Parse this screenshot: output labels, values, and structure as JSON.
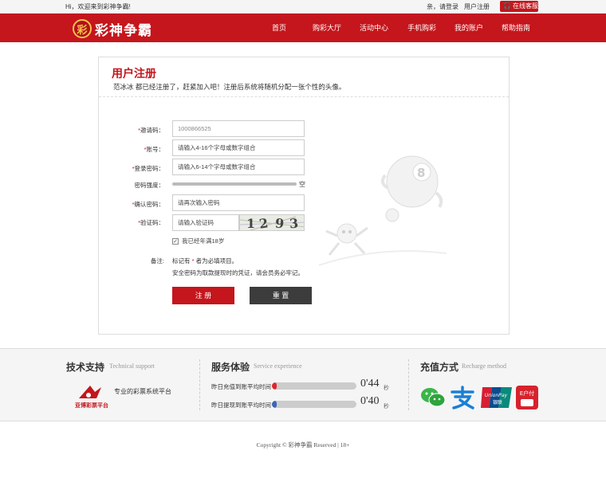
{
  "topbar": {
    "welcome": "Hi，欢迎来到彩神争霸!",
    "login": "亲，请登录",
    "register": "用户注册",
    "service": "在线客服"
  },
  "header": {
    "logo_mark": "彩",
    "logo_name": "彩神争霸",
    "nav": [
      "首页",
      "购彩大厅",
      "活动中心",
      "手机购彩",
      "我的账户",
      "帮助指南"
    ]
  },
  "form": {
    "title": "用户注册",
    "description": "范冰冰 都已经注册了，赶紧加入吧！注册后系统将随机分配一张个性的头像。",
    "invite": {
      "label": "邀请码：",
      "value": "1000866525"
    },
    "account": {
      "label": "账号：",
      "placeholder": "请输入4-16个字母或数字组合"
    },
    "password": {
      "label": "登录密码：",
      "placeholder": "请输入6-14个字母或数字组合"
    },
    "strength": {
      "label": "密码强度：",
      "text": "空"
    },
    "confirm": {
      "label": "确认密码：",
      "placeholder": "请再次输入密码"
    },
    "captcha": {
      "label": "验证码：",
      "placeholder": "请输入验证码",
      "chars": [
        "1",
        "2",
        "9",
        "3"
      ]
    },
    "agree": "我已经年满18岁",
    "note_label": "备注:",
    "note1_pre": "标记有",
    "note1_star": "*",
    "note1_post": "者为必填项目。",
    "note2": "安全密码为取款提现时的凭证，请会员务必牢记。",
    "register_button": "注 册",
    "reset_button": "重 置",
    "required_mark": "*"
  },
  "info": {
    "tech": {
      "title": "技术支持",
      "subtitle": "Technical support",
      "platform_text": "专业的彩票系统平台",
      "logo_text": "亚博彩票平台"
    },
    "service": {
      "title": "服务体验",
      "subtitle": "Service experience",
      "rows": [
        {
          "label": "昨日充值到账平均时间",
          "time": "0'44",
          "unit": "秒",
          "progress": 0.06,
          "color": "#e0262d"
        },
        {
          "label": "昨日提现到账平均时间",
          "time": "0'40",
          "unit": "秒",
          "progress": 0.06,
          "color": "#3a66b8"
        }
      ]
    },
    "recharge": {
      "title": "充值方式",
      "subtitle": "Recharge method",
      "unionpay_text": "UnionPay",
      "unionpay_cn": "银联",
      "epay_text": "E户付"
    }
  },
  "footer": {
    "copyright": "Copyright © 彩神争霸 Reserved | 18+"
  }
}
